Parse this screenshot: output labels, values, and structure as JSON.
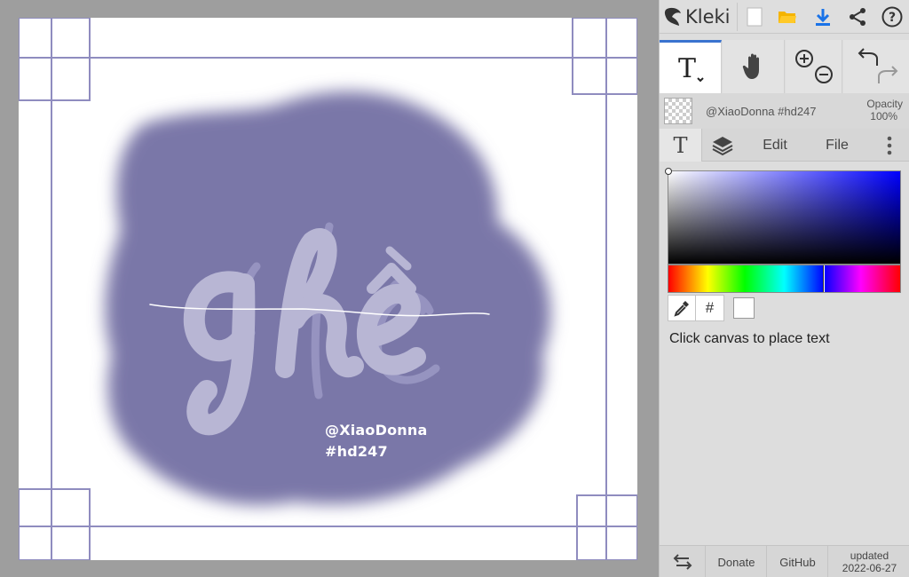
{
  "app": {
    "name": "Kleki"
  },
  "canvas": {
    "signature_line1": "@XiaoDonna",
    "signature_line2": "#hd247",
    "colors": {
      "blob": "#7a77a8",
      "lettering": "#b8b6d4",
      "frame": "#8f8cbf"
    }
  },
  "topbar": {
    "icons": [
      "new-file-icon",
      "open-folder-icon",
      "download-icon",
      "share-icon",
      "help-icon"
    ]
  },
  "tools": {
    "active": "text-tool",
    "items": [
      "text-tool",
      "hand-tool",
      "zoom-tool",
      "undo-redo"
    ]
  },
  "layer": {
    "name": "@XiaoDonna #hd247",
    "opacity_label": "Opacity",
    "opacity_value": "100%"
  },
  "tabs": {
    "text_tab": "T",
    "edit": "Edit",
    "file": "File"
  },
  "color": {
    "hex_symbol": "#",
    "current": "#ffffff",
    "accent": "#3a73cf",
    "hue_fraction": 0.67
  },
  "hint": "Click canvas to place text",
  "footer": {
    "donate": "Donate",
    "github": "GitHub",
    "updated_label": "updated",
    "updated_date": "2022-06-27"
  }
}
